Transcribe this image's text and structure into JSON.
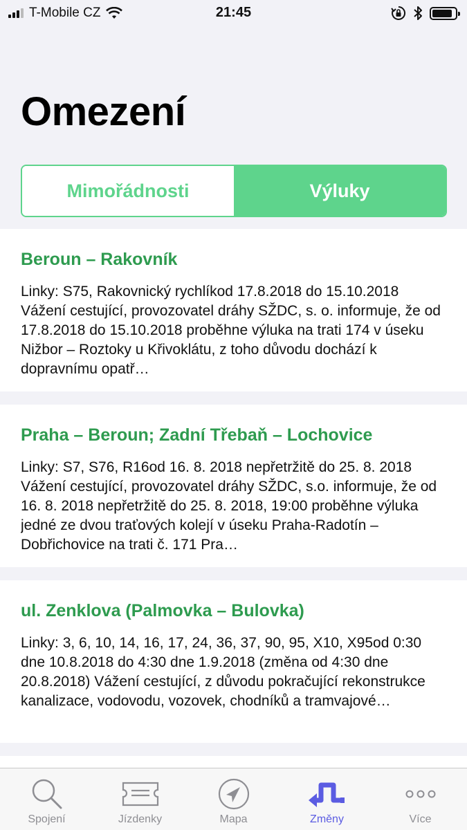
{
  "status_bar": {
    "carrier": "T-Mobile CZ",
    "time": "21:45"
  },
  "page": {
    "title": "Omezení"
  },
  "segments": {
    "left": "Mimořádnosti",
    "right": "Výluky",
    "selected": "Výluky",
    "accent_color": "#5ed48c"
  },
  "items": [
    {
      "title": "Beroun – Rakovník",
      "body": "Linky: S75, Rakovnický rychlíkod 17.8.2018 do 15.10.2018 Vážení cestující, provozovatel dráhy SŽDC, s. o. informuje, že od 17.8.2018 do 15.10.2018 proběhne výluka na trati 174 v úseku Nižbor – Roztoky u Křivoklátu, z toho důvodu dochází k dopravnímu opatř…"
    },
    {
      "title": "Praha – Beroun; Zadní Třebaň – Lochovice",
      "body": "Linky: S7, S76, R16od 16. 8. 2018 nepřetržitě do 25. 8. 2018 Vážení cestující, provozovatel dráhy SŽDC, s.o. informuje, že od 16. 8. 2018 nepřetržitě do 25. 8. 2018, 19:00  proběhne výluka jedné ze dvou traťových kolejí v úseku Praha-Radotín – Dobřichovice na trati č. 171 Pra…"
    },
    {
      "title": "ul. Zenklova (Palmovka – Bulovka)",
      "body": "Linky: 3, 6, 10, 14, 16, 17, 24, 36, 37, 90, 95, X10, X95od 0:30 dne 10.8.2018 do 4:30 dne 1.9.2018 (změna od 4:30 dne 20.8.2018) Vážení cestující, z důvodu pokračující rekonstrukce kanalizace, vodovodu, vozovek, chodníků a tramvajové…"
    }
  ],
  "tabbar": {
    "tabs": [
      {
        "label": "Spojení",
        "icon": "search-icon"
      },
      {
        "label": "Jízdenky",
        "icon": "ticket-icon"
      },
      {
        "label": "Mapa",
        "icon": "map-compass-icon"
      },
      {
        "label": "Změny",
        "icon": "changes-icon"
      },
      {
        "label": "Více",
        "icon": "more-icon"
      }
    ],
    "active": "Změny",
    "active_color": "#5b5ce2",
    "inactive_color": "#8e8e93"
  }
}
